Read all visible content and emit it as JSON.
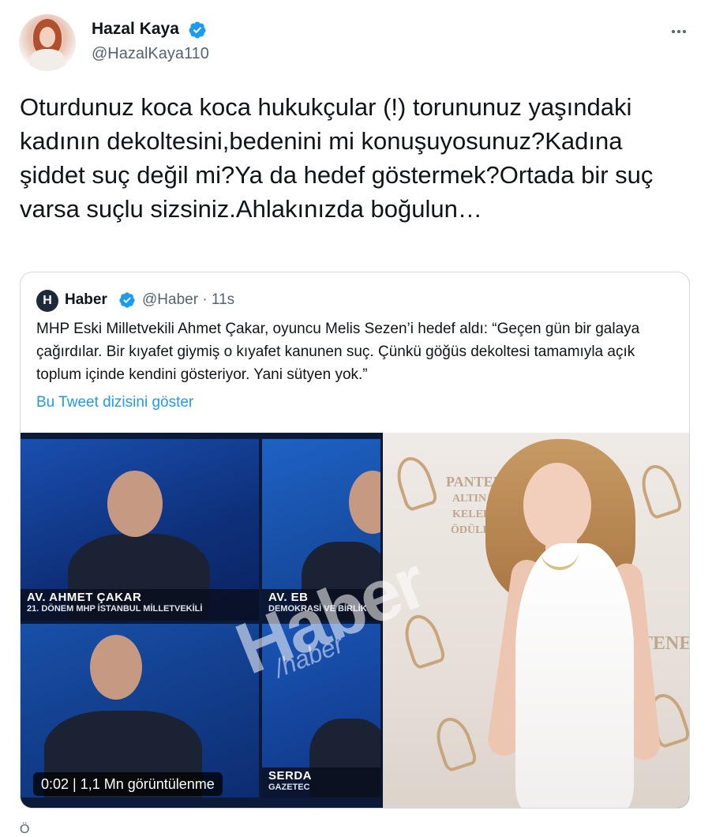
{
  "author": {
    "display_name": "Hazal Kaya",
    "handle": "@HazalKaya110",
    "avatar_icon": "profile-photo",
    "verified_icon": "verified-badge-icon"
  },
  "tweet": {
    "text": "Oturdunuz koca koca hukukçular (!) torununuz yaşındaki kadının dekoltesini,bedenini mi konuşuyosunuz?Kadına şiddet suç değil mi?Ya da hedef göstermek?Ortada bir suç varsa suçlu sizsiniz.Ahlakınızda boğulun…"
  },
  "quote": {
    "logo_letter": "H",
    "display_name": "Haber",
    "handle_time": "@Haber · 11s",
    "text": "MHP Eski Milletvekili Ahmet Çakar, oyuncu Melis Sezen’i hedef aldı: “Geçen gün bir galaya çağırdılar. Bir kıyafet giymiş o kıyafet kanunen suç. Çünkü göğüs dekoltesi tamamıyla açık toplum içinde kendini gösteriyor. Yani sütyen yok.”",
    "thread_link": "Bu Tweet dizisini göster"
  },
  "media": {
    "video_badge": "0:02 | 1,1 Mn görüntülenme",
    "watermark": "Haber",
    "watermark_handle": "/haber",
    "lower_thirds": [
      {
        "name": "AV. AHMET ÇAKAR",
        "role": "21. DÖNEM MHP İSTANBUL MİLLETVEKİLİ"
      },
      {
        "name": "AV. EB",
        "role": "DEMOKRASİ VE BİRLİK"
      },
      {
        "name": "SERDA",
        "role": "GAZETEC"
      }
    ],
    "photo_wall_text": [
      "PANTENE",
      "ALTIN",
      "KELEBEK",
      "ÖDÜLLERİ",
      "TENE"
    ]
  },
  "footer": {
    "cutoff_text": "Ö"
  },
  "colors": {
    "link": "#1d9bf0",
    "secondary_text": "#536471",
    "verified": "#1d9bf0",
    "border": "#cfd9de"
  }
}
